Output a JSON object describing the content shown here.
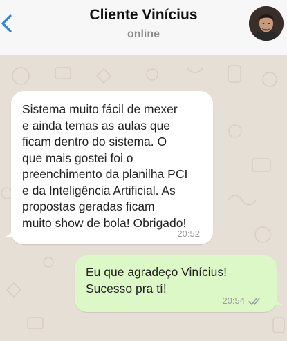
{
  "header": {
    "contact_name": "Cliente Vinícius",
    "status": "online",
    "back_icon": "chevron-left-icon",
    "accent_color": "#2f7fe4"
  },
  "messages": [
    {
      "direction": "incoming",
      "text": "Sistema muito fácil de mexer\ne ainda temas as aulas que\nficam dentro do sistema. O\nque mais gostei foi o\npreenchimento da planilha PCI\ne da Inteligência Artificial. As\npropostas geradas ficam\nmuito show de bola! Obrigado!",
      "time": "20:52",
      "bubble_color": "#ffffff"
    },
    {
      "direction": "outgoing",
      "text": "Eu que agradeço Vinícius!\nSucesso pra tí!",
      "time": "20:54",
      "status_icon": "double-check-icon",
      "bubble_color": "#dcf8c6"
    }
  ]
}
